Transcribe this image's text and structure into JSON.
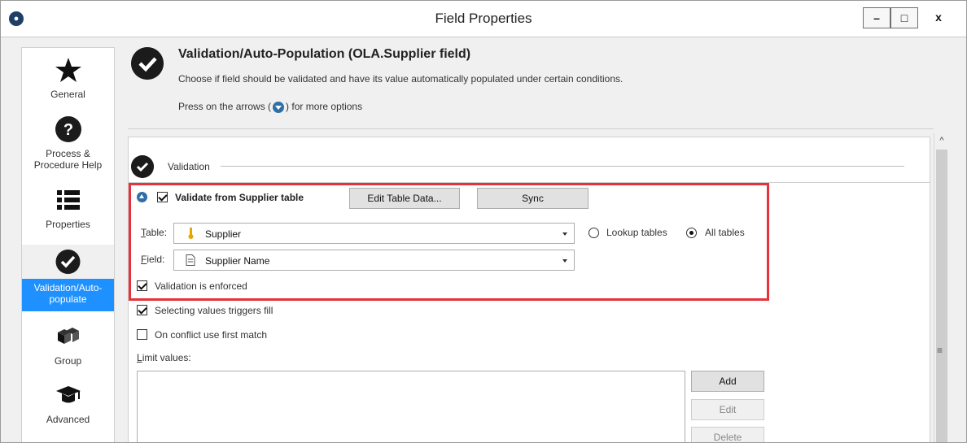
{
  "window": {
    "title": "Field Properties",
    "controls": {
      "minimize": "–",
      "maximize": "□",
      "close": "x"
    }
  },
  "sidebar": {
    "items": [
      {
        "label": "General",
        "icon": "star-icon",
        "selected": false
      },
      {
        "label": "Process & Procedure Help",
        "icon": "help-icon",
        "selected": false
      },
      {
        "label": "Properties",
        "icon": "list-icon",
        "selected": false
      },
      {
        "label": "Validation/Auto-populate",
        "icon": "check-circle-icon",
        "selected": true
      },
      {
        "label": "Group",
        "icon": "cubes-icon",
        "selected": false
      },
      {
        "label": "Advanced",
        "icon": "graduation-cap-icon",
        "selected": false
      }
    ]
  },
  "header": {
    "title": "Validation/Auto-Population (OLA.Supplier field)",
    "description": "Choose if field should be validated and have its value automatically populated under certain conditions.",
    "hint_before": "Press on the arrows (",
    "hint_after": ") for more options"
  },
  "section": {
    "label": "Validation"
  },
  "validate_from": {
    "label": "Validate from Supplier table",
    "checked": true,
    "edit_button": "Edit Table Data...",
    "sync_button": "Sync"
  },
  "table_field": {
    "label_first": "T",
    "label_rest": "able:",
    "value": "Supplier",
    "icon": "key-icon"
  },
  "field_field": {
    "label_first": "F",
    "label_rest": "ield:",
    "value": "Supplier Name",
    "icon": "document-icon"
  },
  "radios": {
    "lookup": {
      "label": "Lookup tables",
      "selected": false
    },
    "all": {
      "label": "All tables",
      "selected": true
    }
  },
  "checkboxes": {
    "enforced": {
      "label": "Validation is enforced",
      "checked": true
    },
    "triggers_fill": {
      "label": "Selecting values triggers fill",
      "checked": true
    },
    "first_match": {
      "label": "On conflict use first match",
      "checked": false
    }
  },
  "limit_values": {
    "label_first": "L",
    "label_rest": "imit values:",
    "buttons": {
      "add": "Add",
      "edit": "Edit",
      "delete": "Delete"
    }
  },
  "colors": {
    "highlight": "#e8313b",
    "selected_nav": "#1e90ff",
    "accent_blue": "#2f6fa7"
  }
}
